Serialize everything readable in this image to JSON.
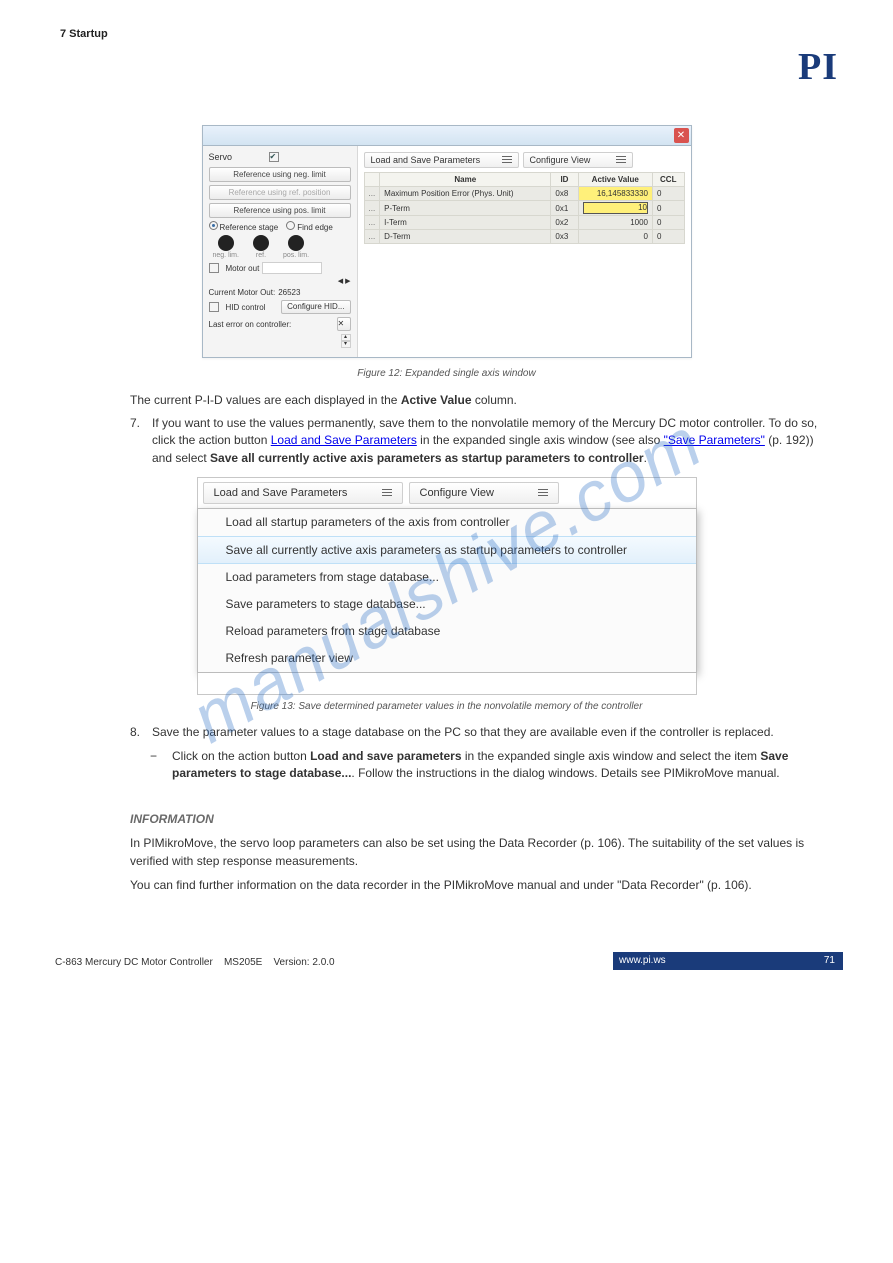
{
  "watermark": "manualshive.com",
  "page_number_top": "7 Startup",
  "logo_text": "PI",
  "win1": {
    "servo_label": "Servo",
    "ref_neg_label": "Reference using neg. limit",
    "ref_ref_label": "Reference using ref. position",
    "ref_pos_label": "Reference using pos. limit",
    "radio_stage": "Reference stage",
    "radio_edge": "Find edge",
    "dot_labels": {
      "neg": "neg. lim.",
      "ref": "ref.",
      "pos": "pos. lim."
    },
    "motor_out_label": "Motor out",
    "current_out_label": "Current Motor Out:",
    "current_out_value": "26523",
    "hid_label": "HID control",
    "hid_button": "Configure HID...",
    "last_error_label": "Last error on controller:",
    "toolbar_load_save": "Load and Save Parameters",
    "toolbar_configure": "Configure View",
    "table_headers": {
      "name": "Name",
      "id": "ID",
      "active": "Active Value",
      "ccl": "CCL"
    },
    "rows": [
      {
        "name": "Maximum Position Error (Phys. Unit)",
        "id": "0x8",
        "value": "16,145833330",
        "ccl": "0",
        "class": "yellow"
      },
      {
        "name": "P-Term",
        "id": "0x1",
        "value": "10",
        "ccl": "0",
        "class": "yellow-input"
      },
      {
        "name": "I-Term",
        "id": "0x2",
        "value": "1000",
        "ccl": "0",
        "class": "rval"
      },
      {
        "name": "D-Term",
        "id": "0x3",
        "value": "0",
        "ccl": "0",
        "class": "rval"
      }
    ]
  },
  "figure12_caption": "Figure 12: Expanded single axis window",
  "para1_pre": "The current P-I-D values are each displayed in the ",
  "para1_bold": "Active Value",
  "para1_post": " column.",
  "step7_n": "7.",
  "step7_a": "If you want to use the values permanently, save them to the nonvolatile memory of the Mercury DC motor controller. To do so, click the action button ",
  "step7_link": "Load and Save Parameters",
  "step7_b": " in the expanded single axis window (see also ",
  "step7_c": "\"Save Parameters\"",
  "step7_d": " (p. 192)) and select ",
  "step7_bold": "Save all currently active axis parameters as startup parameters to controller",
  "step7_e": ".",
  "win2": {
    "btn_load_save": "Load and Save Parameters",
    "btn_configure": "Configure View",
    "items": [
      "Load all startup parameters of the axis from controller",
      "Save all currently active axis parameters as startup parameters to controller",
      "Load parameters from stage database...",
      "Save parameters to stage database...",
      "Reload parameters from stage database",
      "Refresh parameter view"
    ],
    "highlight_index": 1
  },
  "figure13_caption": "Figure 13: Save determined parameter values in the nonvolatile memory of the controller",
  "step8_n": "8.",
  "step8_t": "Save the parameter values to a stage database on the PC so that they are available even if the controller is replaced.",
  "bullet_marker": "−",
  "bullet_a": "Click on the action button ",
  "bullet_bold1": "Load and save parameters",
  "bullet_b": " in the expanded single axis window and select the item ",
  "bullet_bold2": "Save parameters to stage database...",
  "bullet_c": ". Follow the instructions in the dialog windows. Details see PIMikroMove manual.",
  "info_heading": "INFORMATION",
  "info_p1": "In PIMikroMove, the servo loop parameters can also be set using the Data Recorder (p. 106). The suitability of the set values is verified with step response measurements.",
  "info_p2_a": "You can find further information on the data recorder in the PIMikroMove manual and under \"Data Recorder\" (p. 106).",
  "footer_left_a": "C-863 Mercury DC Motor Controller",
  "footer_left_b": "MS205E",
  "footer_left_c": "Version: 2.0.0",
  "footer_right": "www.pi.ws",
  "footer_page": "71"
}
